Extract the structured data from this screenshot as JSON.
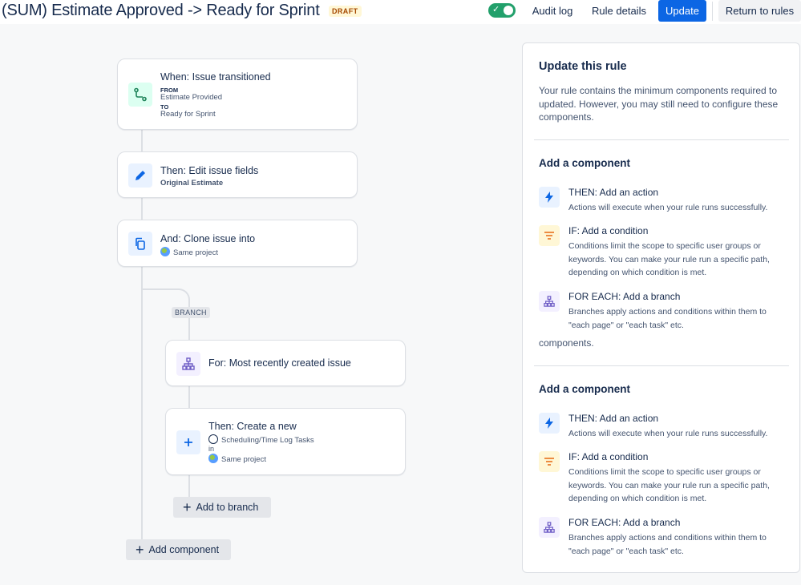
{
  "header": {
    "title": "(SUM) Estimate Approved -> Ready for Sprint",
    "badge": "DRAFT",
    "toggle_checkmark": "✓",
    "audit_log": "Audit log",
    "rule_details": "Rule details",
    "update": "Update",
    "return_to_rules": "Return to rules"
  },
  "flow": {
    "trigger": {
      "title": "When: Issue transitioned",
      "from_label": "FROM",
      "from_value": "Estimate Provided",
      "to_label": "TO",
      "to_value": "Ready for Sprint"
    },
    "edit": {
      "title": "Then: Edit issue fields",
      "subtitle": "Original Estimate"
    },
    "clone": {
      "title": "And: Clone issue into",
      "subtitle": "Same project"
    },
    "branch_tag": "BRANCH",
    "branch": {
      "title": "For: Most recently created issue"
    },
    "create": {
      "title": "Then: Create a new",
      "issue_type": "Scheduling/Time Log Tasks",
      "in_label": "in",
      "project": "Same project"
    },
    "add_to_branch": "Add to branch",
    "add_component": "Add component",
    "plus": "+"
  },
  "panel": {
    "title": "Update this rule",
    "description": "Your rule contains the minimum components required to updated. However, you may still need to configure these components.",
    "section1": {
      "title": "Add a component",
      "items": [
        {
          "title": "THEN: Add an action",
          "desc": "Actions will execute when your rule runs successfully."
        },
        {
          "title": "IF: Add a condition",
          "desc": "Conditions limit the scope to specific user groups or keywords. You can make your rule run a specific path, depending on which condition is met."
        },
        {
          "title": "FOR EACH: Add a branch",
          "desc": "Branches apply actions and conditions within them to \"each page\" or \"each task\" etc."
        }
      ]
    },
    "trailing_text": "components.",
    "section2": {
      "title": "Add a component",
      "items": [
        {
          "title": "THEN: Add an action",
          "desc": "Actions will execute when your rule runs successfully."
        },
        {
          "title": "IF: Add a condition",
          "desc": "Conditions limit the scope to specific user groups or keywords. You can make your rule run a specific path, depending on which condition is met."
        },
        {
          "title": "FOR EACH: Add a branch",
          "desc": "Branches apply actions and conditions within them to \"each page\" or \"each task\" etc."
        }
      ]
    }
  },
  "colors": {
    "trigger_icon_bg": "#dcfff1",
    "action_icon_bg": "#e9f2ff",
    "condition_icon_bg": "#fff7d6",
    "branch_icon_bg": "#f3f0ff",
    "primary": "#0c66e4",
    "toggle_on": "#22a06b"
  },
  "icons": {
    "trigger": "transition-icon",
    "edit": "pencil-icon",
    "clone": "copy-icon",
    "branch": "branch-icon",
    "create": "plus-icon",
    "action": "lightning-icon",
    "condition": "filter-icon"
  }
}
